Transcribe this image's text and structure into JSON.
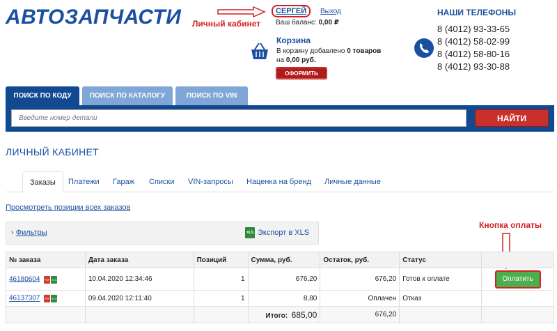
{
  "header": {
    "logo": "АВТОЗАПЧАСТИ",
    "user_name": "СЕРГЕЙ",
    "logout": "Выход",
    "balance_label": "Ваш баланс:",
    "balance_value": "0,00 ₽",
    "annotation_cabinet": "Личный кабинет"
  },
  "cart": {
    "title": "Корзина",
    "line1_prefix": "В корзину добавлено",
    "line1_count": "0 товаров",
    "line2_prefix": "на",
    "line2_sum": "0,00 руб.",
    "checkout": "ОФОРМИТЬ"
  },
  "phones": {
    "title": "НАШИ ТЕЛЕФОНЫ",
    "list": [
      "8 (4012) 93-33-65",
      "8 (4012) 58-02-99",
      "8 (4012) 58-80-16",
      "8 (4012) 93-30-88"
    ]
  },
  "search": {
    "tabs": [
      "ПОИСК ПО КОДУ",
      "ПОИСК ПО КАТАЛОГУ",
      "ПОИСК ПО VIN"
    ],
    "placeholder": "Введите номер детали",
    "button": "НАЙТИ"
  },
  "cabinet": {
    "title": "ЛИЧНЫЙ КАБИНЕТ",
    "nav": [
      "Заказы",
      "Платежи",
      "Гараж",
      "Списки",
      "VIN-запросы",
      "Наценка на бренд",
      "Личные данные"
    ],
    "all_orders_link": "Просмотреть позиции всех заказов",
    "filters": "Фильтры",
    "export": "Экспорт в XLS",
    "annotation_pay": "Кнопка оплаты"
  },
  "table": {
    "headers": [
      "№ заказа",
      "Дата заказа",
      "Позиций",
      "Сумма, руб.",
      "Остаток, руб.",
      "Статус",
      ""
    ],
    "rows": [
      {
        "id": "46180604",
        "date": "10.04.2020 12:34:46",
        "positions": "1",
        "sum": "676,20",
        "rest": "676,20",
        "status": "Готов к оплате",
        "action": "Оплатить"
      },
      {
        "id": "46137307",
        "date": "09.04.2020 12:11:40",
        "positions": "1",
        "sum": "8,80",
        "rest": "Оплачен",
        "status": "Отказ",
        "action": ""
      }
    ],
    "total_label": "Итого:",
    "total_sum": "685,00",
    "total_rest": "676,20"
  },
  "colors": {
    "brand_blue": "#1b4fa0",
    "search_bar": "#124a92",
    "tab_inactive": "#7fa6d6",
    "accent_red": "#d42020",
    "pay_green": "#4cae4c"
  }
}
